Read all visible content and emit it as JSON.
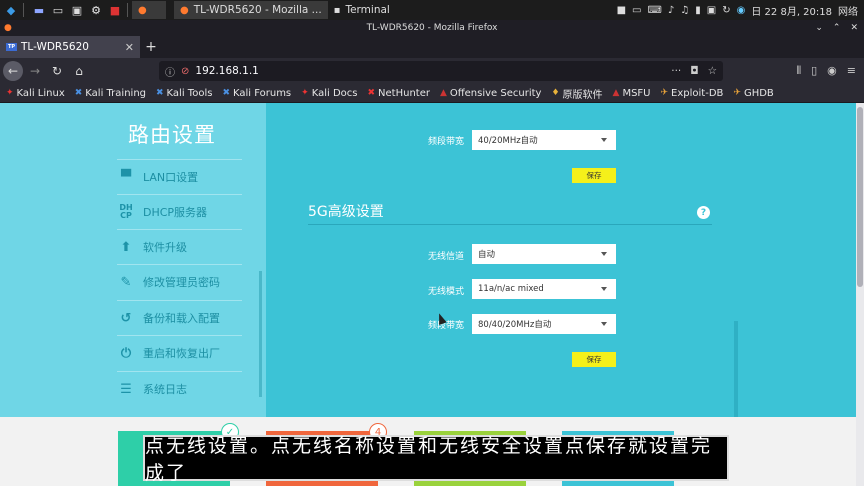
{
  "taskbar": {
    "tasks": [
      {
        "label": "TL-WDR5620 - Mozilla ..."
      },
      {
        "label": "Terminal"
      }
    ],
    "clock": "日 22 8月, 20:18",
    "network": "网络"
  },
  "browser": {
    "window_title": "TL-WDR5620 - Mozilla Firefox",
    "tab_label": "TL-WDR5620",
    "favicon_text": "TP",
    "url": "192.168.1.1",
    "bookmarks": [
      {
        "label": "Kali Linux"
      },
      {
        "label": "Kali Training"
      },
      {
        "label": "Kali Tools"
      },
      {
        "label": "Kali Forums"
      },
      {
        "label": "Kali Docs"
      },
      {
        "label": "NetHunter"
      },
      {
        "label": "Offensive Security"
      },
      {
        "label": "原版软件"
      },
      {
        "label": "MSFU"
      },
      {
        "label": "Exploit-DB"
      },
      {
        "label": "GHDB"
      }
    ]
  },
  "sidebar": {
    "title": "路由设置",
    "items": [
      {
        "label": "LAN口设置",
        "icon": "lan-icon"
      },
      {
        "label": "DHCP服务器",
        "icon": "dhcp-icon"
      },
      {
        "label": "软件升级",
        "icon": "upload-icon"
      },
      {
        "label": "修改管理员密码",
        "icon": "pencil-icon"
      },
      {
        "label": "备份和载入配置",
        "icon": "restore-icon"
      },
      {
        "label": "重启和恢复出厂",
        "icon": "power-icon"
      },
      {
        "label": "系统日志",
        "icon": "list-icon"
      }
    ]
  },
  "main": {
    "band24": {
      "bandwidth_label": "频段带宽",
      "bandwidth_value": "40/20MHz自动",
      "save_label": "保存"
    },
    "band5": {
      "section_title": "5G高级设置",
      "help": "?",
      "channel_label": "无线信道",
      "channel_value": "自动",
      "mode_label": "无线模式",
      "mode_value": "11a/n/ac mixed",
      "bandwidth_label": "频段带宽",
      "bandwidth_value": "80/40/20MHz自动",
      "save_label": "保存"
    }
  },
  "steps": [
    {
      "bubble": "✓",
      "color": "#2ecfa8"
    },
    {
      "bubble": "4",
      "color": "#f0663c"
    },
    {
      "bubble": "",
      "color": "#9ad23c"
    },
    {
      "bubble": "",
      "color": "#3cc3d6"
    }
  ],
  "subtitle": "点无线设置。点无线名称设置和无线安全设置点保存就设置完成了",
  "colors": {
    "sidebar_bg": "#6fd6e6",
    "main_bg": "#3cc3d6",
    "save_button": "#f5f01a"
  }
}
